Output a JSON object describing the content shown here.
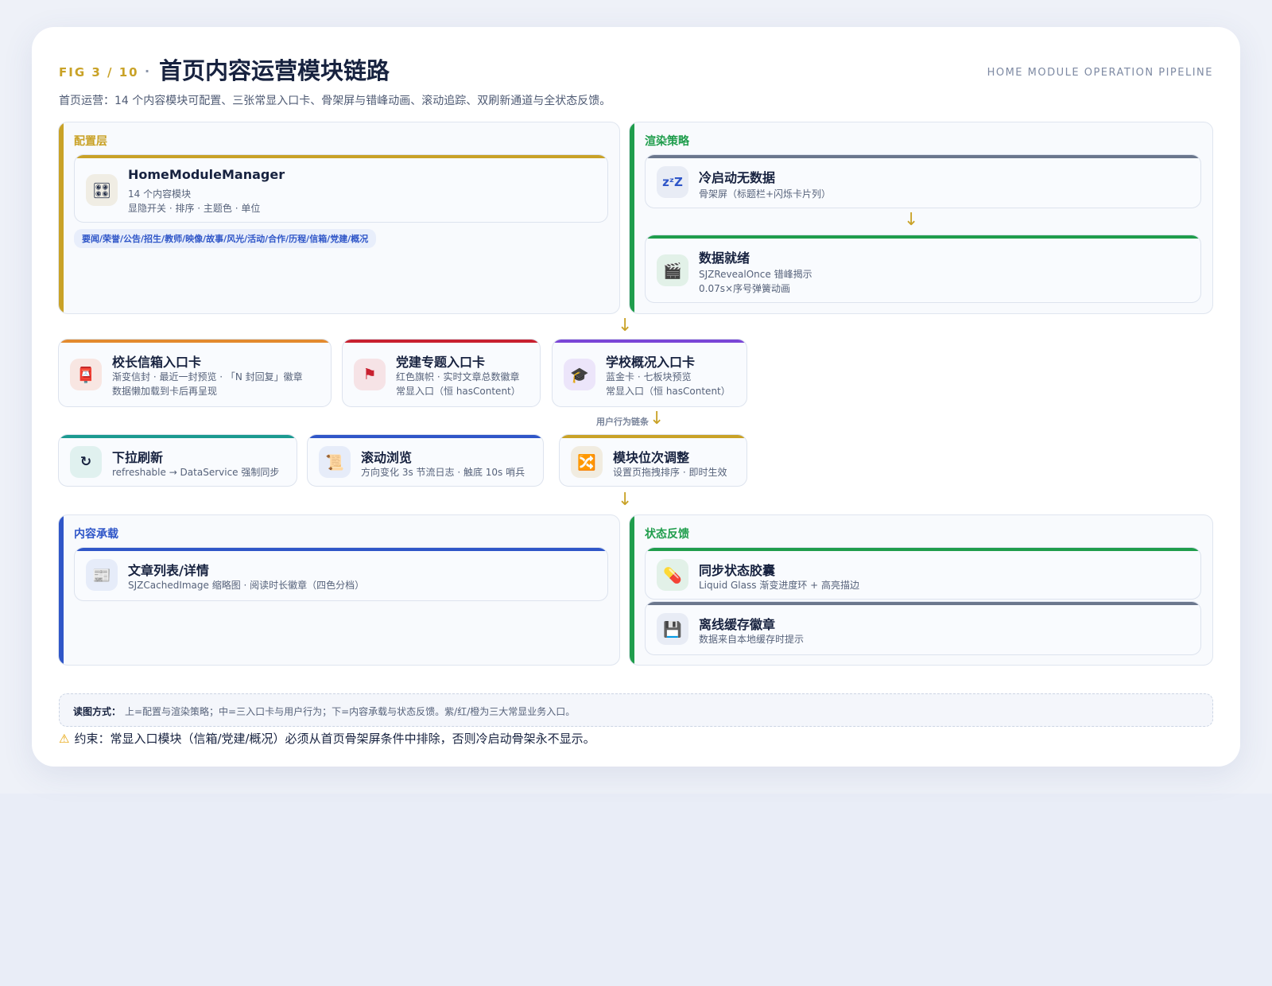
{
  "header": {
    "fig_label": "FIG 3 / 10",
    "dot": "·",
    "title": "首页内容运营模块链路",
    "subtitle_en": "HOME MODULE OPERATION PIPELINE",
    "description": "首页运营：14 个内容模块可配置、三张常显入口卡、骨架屏与错峰动画、滚动追踪、双刷新通道与全状态反馈。"
  },
  "colors": {
    "gold": "#c9a227",
    "green": "#1f9d4c",
    "blue": "#2f56c8",
    "slate": "#6b778d",
    "orange": "#e38a2e",
    "red": "#c8202f",
    "purple": "#7a46d6",
    "teal": "#1b9a90"
  },
  "config_panel": {
    "title": "配置层",
    "node": {
      "icon": "control-knobs-icon",
      "title": "HomeModuleManager",
      "line1": "14 个内容模块",
      "line2": "显隐开关 · 排序 · 主题色 · 单位"
    },
    "tags": "要闻/荣誉/公告/招生/教师/映像/故事/风光/活动/合作/历程/信箱/党建/概况"
  },
  "render_panel": {
    "title": "渲染策略",
    "cold_start": {
      "icon": "sleep-zzz-icon",
      "title": "冷启动无数据",
      "line1": "骨架屏（标题栏+闪烁卡片列）"
    },
    "data_ready": {
      "icon": "clapper-board-icon",
      "title": "数据就绪",
      "line1": "SJZRevealOnce 错峰揭示",
      "line2": "0.07s×序号弹簧动画"
    }
  },
  "entry_cards": [
    {
      "icon": "postbox-icon",
      "title": "校长信箱入口卡",
      "line1": "渐变信封 · 最近一封预览 · 「N 封回复」徽章",
      "line2": "数据懒加载到卡后再呈现"
    },
    {
      "icon": "red-flag-icon",
      "title": "党建专题入口卡",
      "line1": "红色旗帜 · 实时文章总数徽章",
      "line2": "常显入口（恒 hasContent）"
    },
    {
      "icon": "graduation-cap-icon",
      "title": "学校概况入口卡",
      "line1": "蓝金卡 · 七板块预览",
      "line2": "常显入口（恒 hasContent）"
    }
  ],
  "user_behavior_label": "用户行为链条",
  "behavior_cards": [
    {
      "icon": "refresh-icon",
      "title": "下拉刷新",
      "line1": "refreshable → DataService 强制同步"
    },
    {
      "icon": "scroll-icon",
      "title": "滚动浏览",
      "line1": "方向变化 3s 节流日志 · 触底 10s 哨兵"
    },
    {
      "icon": "shuffle-icon",
      "title": "模块位次调整",
      "line1": "设置页拖拽排序 · 即时生效"
    }
  ],
  "content_panel": {
    "title": "内容承载",
    "node": {
      "icon": "newspaper-icon",
      "title": "文章列表/详情",
      "line1": "SJZCachedImage 缩略图 · 阅读时长徽章（四色分档）"
    }
  },
  "status_panel": {
    "title": "状态反馈",
    "sync": {
      "icon": "capsule-pill-icon",
      "title": "同步状态胶囊",
      "line1": "Liquid Glass 渐变进度环 + 高亮描边"
    },
    "offline": {
      "icon": "floppy-disk-icon",
      "title": "离线缓存徽章",
      "line1": "数据来自本地缓存时提示"
    }
  },
  "reading": {
    "label": "读图方式：",
    "text": "上=配置与渲染策略；中=三入口卡与用户行为；下=内容承载与状态反馈。紫/红/橙为三大常显业务入口。"
  },
  "warning": {
    "icon": "warning-icon",
    "text": "约束：常显入口模块（信箱/党建/概况）必须从首页骨架屏条件中排除，否则冷启动骨架永不显示。"
  },
  "arrow_glyph": "↓"
}
